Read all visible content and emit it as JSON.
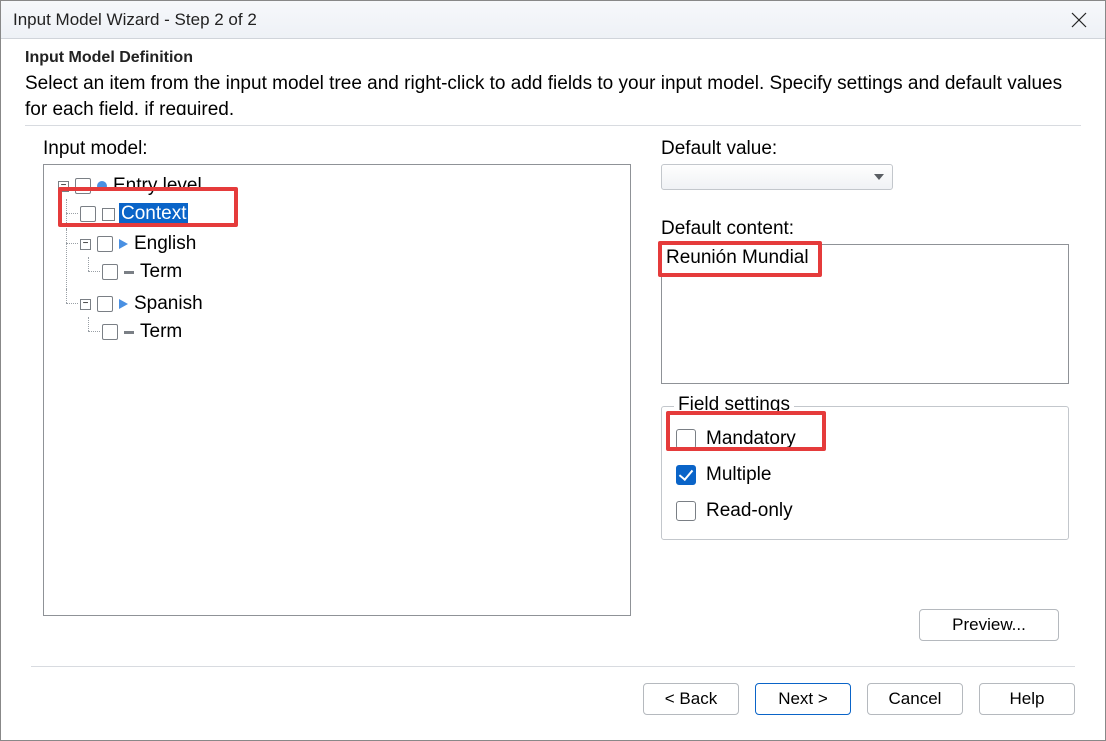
{
  "window": {
    "title": "Input Model Wizard - Step 2 of 2"
  },
  "header": {
    "title": "Input Model Definition",
    "description": "Select an item from the input model tree and right-click to add fields to your input model. Specify settings and default values for each field, if required."
  },
  "left": {
    "label": "Input model:",
    "tree": {
      "entry_level": "Entry level",
      "context": "Context",
      "english": "English",
      "english_term": "Term",
      "spanish": "Spanish",
      "spanish_term": "Term"
    }
  },
  "right": {
    "default_value_label": "Default value:",
    "default_content_label": "Default content:",
    "default_content_value": "Reunión Mundial",
    "field_settings_label": "Field settings",
    "mandatory_label": "Mandatory",
    "multiple_label": "Multiple",
    "readonly_label": "Read-only"
  },
  "buttons": {
    "preview": "Preview...",
    "back": "< Back",
    "next": "Next >",
    "cancel": "Cancel",
    "help": "Help"
  }
}
